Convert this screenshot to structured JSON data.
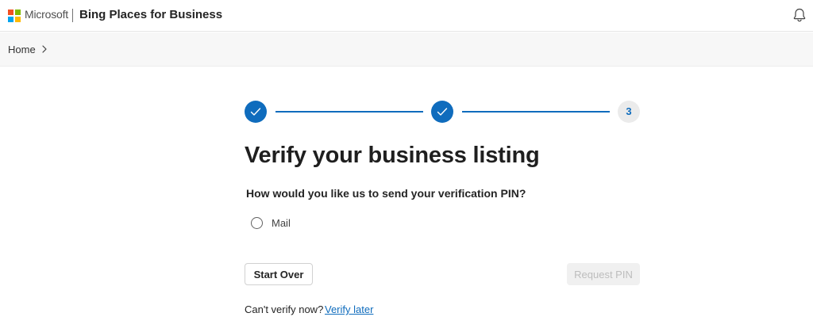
{
  "header": {
    "brand": "Microsoft",
    "app_title": "Bing Places for Business",
    "notification_icon": "bell-icon"
  },
  "breadcrumb": {
    "home": "Home",
    "separator_icon": "chevron-right-icon"
  },
  "stepper": {
    "steps": [
      {
        "state": "completed",
        "icon": "checkmark-icon"
      },
      {
        "state": "completed",
        "icon": "checkmark-icon"
      },
      {
        "state": "current",
        "label": "3"
      }
    ]
  },
  "main": {
    "title": "Verify your business listing",
    "question": "How would you like us to send your verification PIN?",
    "options": [
      {
        "label": "Mail",
        "selected": false
      }
    ],
    "start_over_label": "Start Over",
    "request_pin_label": "Request PIN",
    "cant_verify_text": "Can't verify now?",
    "verify_later_label": "Verify later"
  },
  "colors": {
    "accent": "#0f6cbd",
    "ms_red": "#f25022",
    "ms_green": "#7fba00",
    "ms_blue": "#00a4ef",
    "ms_yellow": "#ffb900"
  }
}
